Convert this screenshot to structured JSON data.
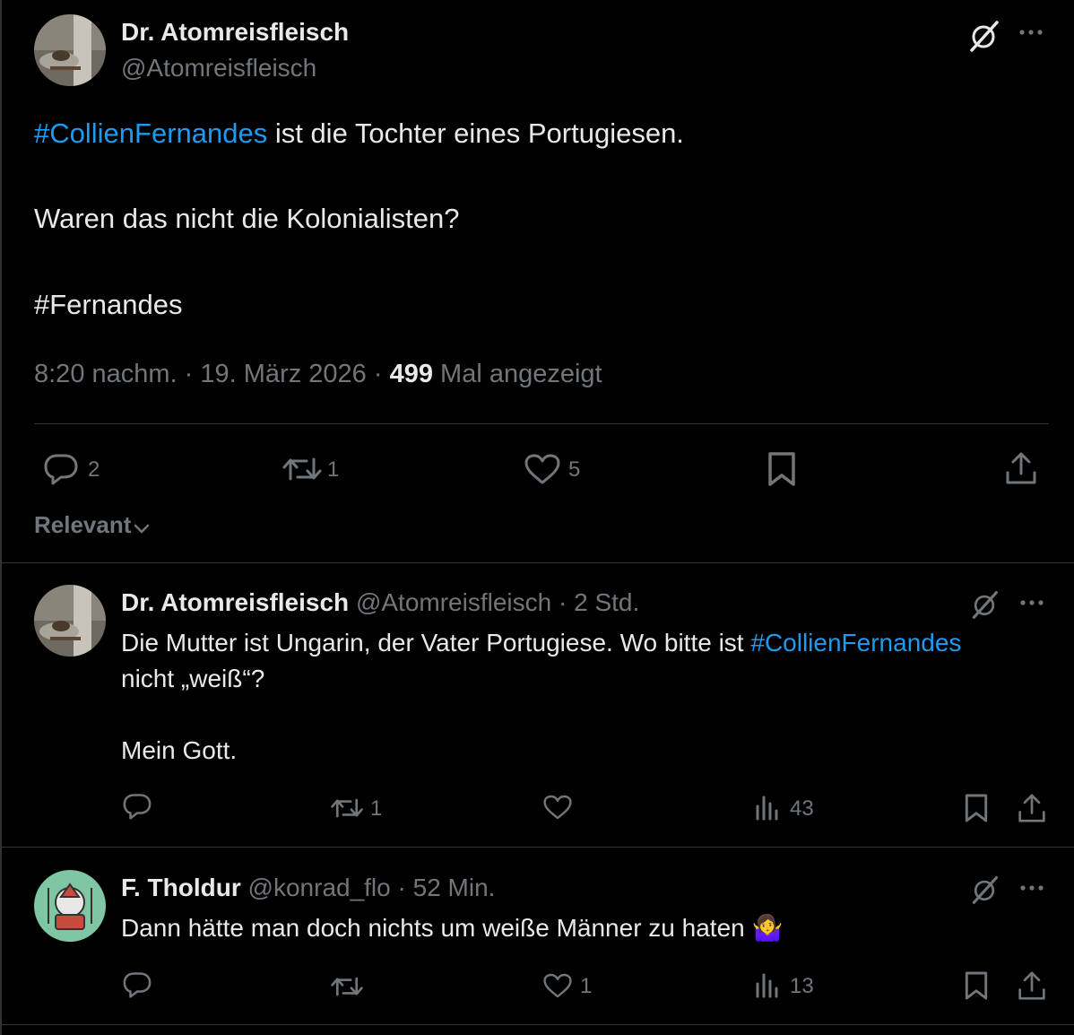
{
  "main_post": {
    "author_name": "Dr. Atomreisfleisch",
    "author_handle": "@Atomreisfleisch",
    "line1_hashtag": "#CollienFernandes",
    "line1_rest": " ist die Tochter eines Portugiesen.",
    "line2": "Waren das nicht die Kolonialisten?",
    "line3_hashtag": "#Fernandes",
    "time": "8:20 nachm.",
    "sep1": "·",
    "date": "19. März 2026",
    "sep2": "·",
    "views_count": "499",
    "views_label": "Mal angezeigt",
    "replies": "2",
    "reposts": "1",
    "likes": "5"
  },
  "sort_label": "Relevant",
  "replies": [
    {
      "author_name": "Dr. Atomreisfleisch",
      "author_handle": "@Atomreisfleisch",
      "age": "· 2 Std.",
      "text_part1": "Die Mutter ist Ungarin, der Vater Portugiese. Wo bitte ist ",
      "text_hashtag": "#CollienFernandes",
      "text_part2": "nicht „weiß“?",
      "text_part3": "Mein Gott.",
      "reposts": "1",
      "views": "43"
    },
    {
      "author_name": "F. Tholdur",
      "author_handle": "@konrad_flo",
      "age": "· 52 Min.",
      "text": "Dann hätte man doch nichts um weiße Männer zu haten 🤷‍♀️",
      "likes": "1",
      "views": "13"
    }
  ],
  "icons": {
    "grok": "grok-slash-icon",
    "more": "more-dots-icon",
    "reply": "reply-bubble-icon",
    "repost": "repost-icon",
    "like": "heart-icon",
    "bookmark": "bookmark-icon",
    "share": "share-icon",
    "views": "views-bars-icon",
    "chevron": "chevron-down-icon"
  },
  "colors": {
    "background": "#000000",
    "text": "#e7e9ea",
    "muted": "#71767b",
    "link": "#1d9bf0",
    "divider": "#2f3336"
  }
}
